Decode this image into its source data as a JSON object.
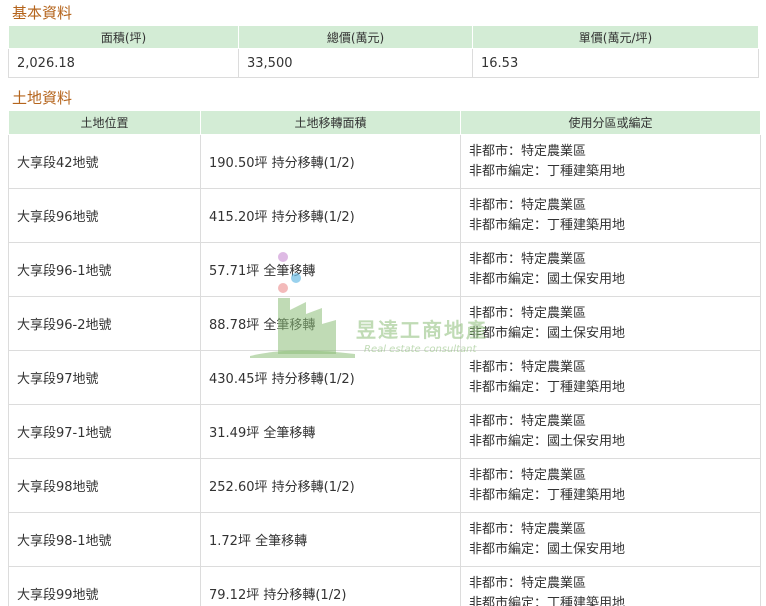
{
  "basic": {
    "title": "基本資料",
    "headers": [
      "面積(坪)",
      "總價(萬元)",
      "單價(萬元/坪)"
    ],
    "values": [
      "2,026.18",
      "33,500",
      "16.53"
    ]
  },
  "land": {
    "title": "土地資料",
    "headers": [
      "土地位置",
      "土地移轉面積",
      "使用分區或編定"
    ],
    "rows": [
      {
        "location": "大享段42地號",
        "area": "190.50坪 持分移轉(1/2)",
        "zone1": "非都市：特定農業區",
        "zone2": "非都市編定：丁種建築用地"
      },
      {
        "location": "大享段96地號",
        "area": "415.20坪 持分移轉(1/2)",
        "zone1": "非都市：特定農業區",
        "zone2": "非都市編定：丁種建築用地"
      },
      {
        "location": "大享段96-1地號",
        "area": "57.71坪 全筆移轉",
        "zone1": "非都市：特定農業區",
        "zone2": "非都市編定：國土保安用地"
      },
      {
        "location": "大享段96-2地號",
        "area": "88.78坪 全筆移轉",
        "zone1": "非都市：特定農業區",
        "zone2": "非都市編定：國土保安用地"
      },
      {
        "location": "大享段97地號",
        "area": "430.45坪 持分移轉(1/2)",
        "zone1": "非都市：特定農業區",
        "zone2": "非都市編定：丁種建築用地"
      },
      {
        "location": "大享段97-1地號",
        "area": "31.49坪 全筆移轉",
        "zone1": "非都市：特定農業區",
        "zone2": "非都市編定：國土保安用地"
      },
      {
        "location": "大享段98地號",
        "area": "252.60坪 持分移轉(1/2)",
        "zone1": "非都市：特定農業區",
        "zone2": "非都市編定：丁種建築用地"
      },
      {
        "location": "大享段98-1地號",
        "area": "1.72坪 全筆移轉",
        "zone1": "非都市：特定農業區",
        "zone2": "非都市編定：國土保安用地"
      },
      {
        "location": "大享段99地號",
        "area": "79.12坪 持分移轉(1/2)",
        "zone1": "非都市：特定農業區",
        "zone2": "非都市編定：丁種建築用地"
      }
    ]
  },
  "watermark": {
    "name": "昱達工商地產",
    "subtitle": "Real estate consultant",
    "color": "#8cbe78"
  }
}
